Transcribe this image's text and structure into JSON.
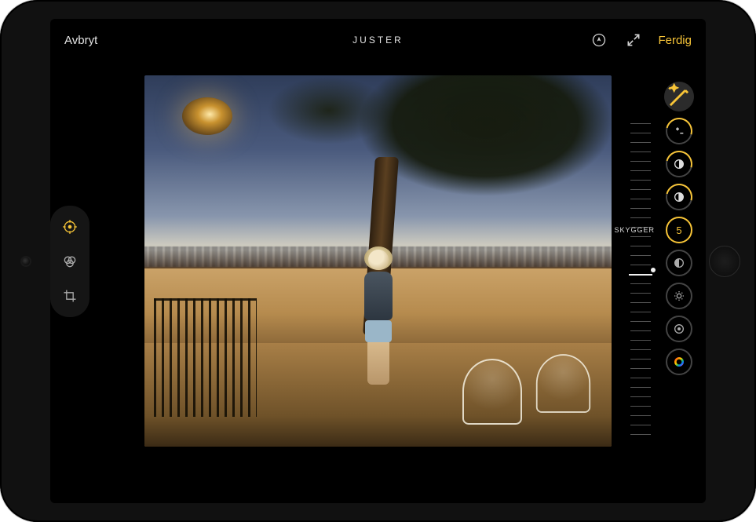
{
  "topbar": {
    "cancel_label": "Avbryt",
    "title": "JUSTER",
    "fullscreen_icon": "fullscreen-icon",
    "markup_icon": "markup-pen-icon",
    "done_label": "Ferdig"
  },
  "mode_strip": {
    "items": [
      {
        "name": "adjust",
        "icon": "adjust-dial-icon",
        "active": true
      },
      {
        "name": "filters",
        "icon": "filters-triple-circle-icon",
        "active": false
      },
      {
        "name": "crop",
        "icon": "crop-rotate-icon",
        "active": false
      }
    ]
  },
  "adjustments": {
    "auto_enhance_icon": "magic-wand-icon",
    "selected_label": "SKYGGER",
    "selected_value": "5",
    "items": [
      {
        "name": "exposure",
        "icon": "plus-minus-icon",
        "ringed": true,
        "selected": false
      },
      {
        "name": "brilliance",
        "icon": "half-circle-icon",
        "ringed": true,
        "selected": false
      },
      {
        "name": "highlights",
        "icon": "half-split-icon",
        "ringed": true,
        "selected": false
      },
      {
        "name": "shadows",
        "icon": "value",
        "ringed": false,
        "selected": true
      },
      {
        "name": "contrast",
        "icon": "half-circle-alt-icon",
        "ringed": false,
        "selected": false
      },
      {
        "name": "brightness",
        "icon": "sun-icon",
        "ringed": false,
        "selected": false
      },
      {
        "name": "blackpoint",
        "icon": "dot-ring-icon",
        "ringed": false,
        "selected": false
      },
      {
        "name": "saturation",
        "icon": "spectrum-ring-icon",
        "ringed": false,
        "selected": false
      }
    ]
  },
  "ruler": {
    "position_percent": 48
  },
  "colors": {
    "accent": "#f7c437"
  }
}
